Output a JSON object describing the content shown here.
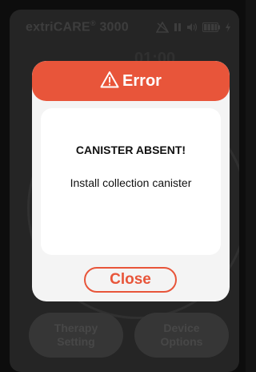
{
  "status_bar": {
    "brand_name": "extriCARE",
    "brand_suffix": "3000",
    "registered_mark": "®"
  },
  "background": {
    "time_partial": "01:00",
    "buttons": [
      {
        "label": "Therapy\nSetting"
      },
      {
        "label": "Device\nOptions"
      }
    ]
  },
  "dialog": {
    "title": "Error",
    "heading": "CANISTER ABSENT!",
    "message": "Install collection canister",
    "close_label": "Close",
    "accent_color": "#e8553a"
  },
  "icons": [
    "warning-icon",
    "alarm-muted-icon",
    "pause-icon",
    "volume-icon",
    "battery-icon",
    "charging-icon"
  ]
}
